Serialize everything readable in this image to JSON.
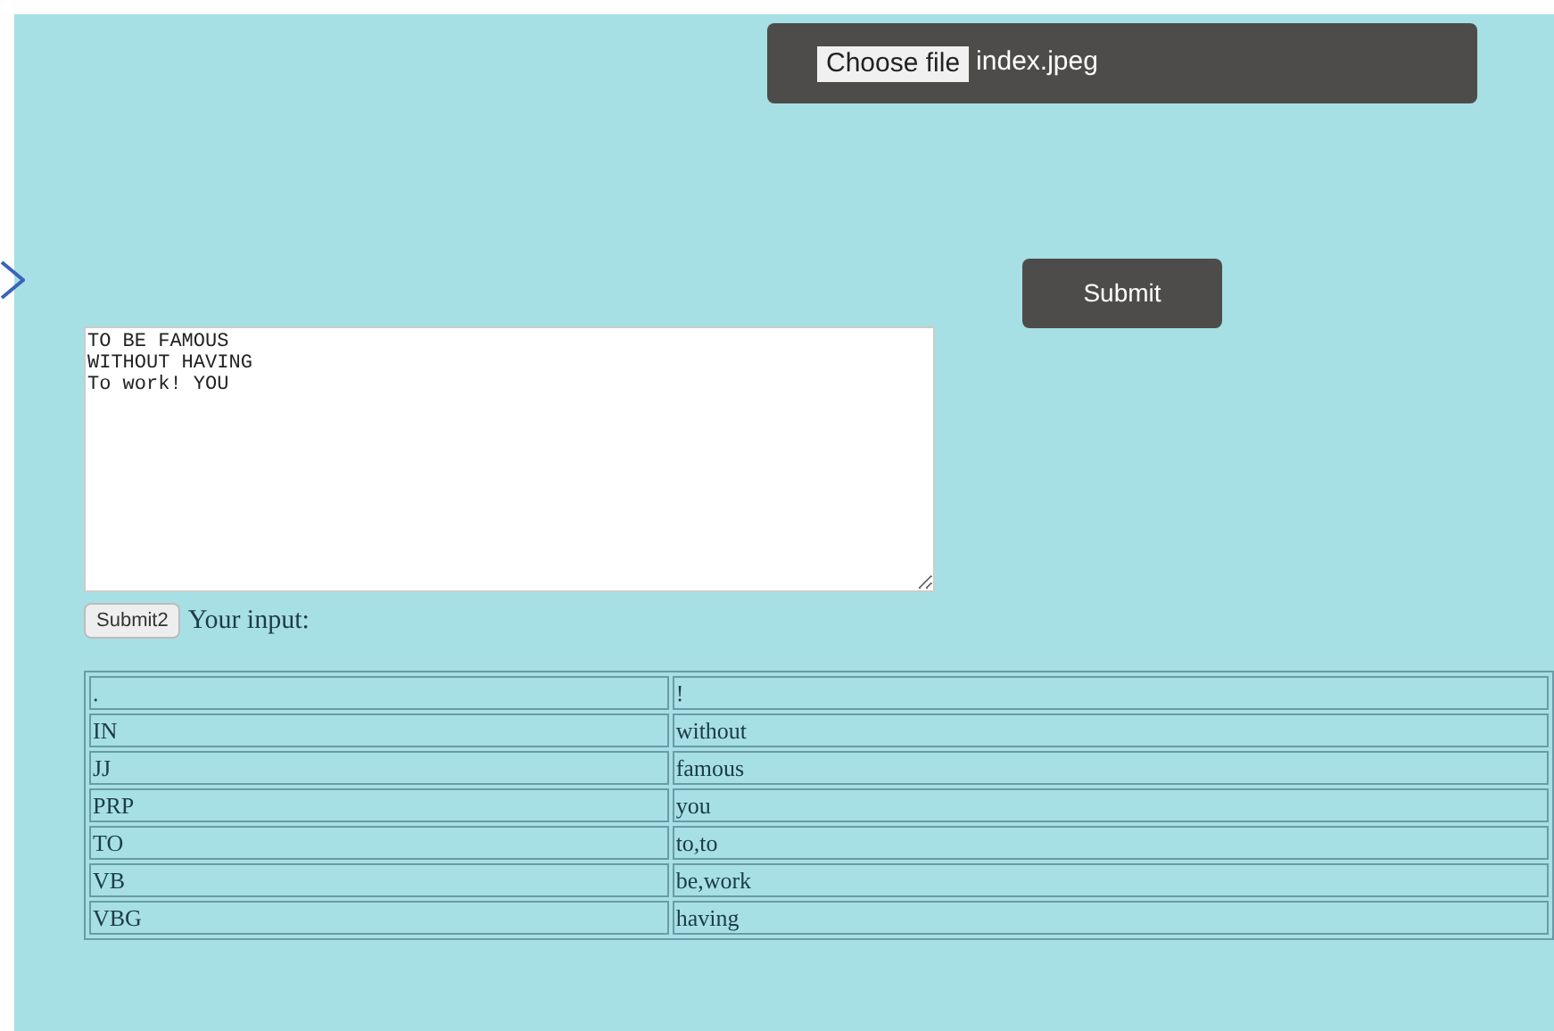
{
  "file_picker": {
    "button": "Choose file",
    "file_name": "index.jpeg"
  },
  "submit_button": "Submit",
  "textarea": {
    "value": "TO BE FAMOUS\nWITHOUT HAVING\nTo work! YOU"
  },
  "submit2_button": "Submit2",
  "result_label": "Your input:",
  "table": {
    "rows": [
      [
        ".",
        "!"
      ],
      [
        "IN",
        "without"
      ],
      [
        "JJ",
        "famous"
      ],
      [
        "PRP",
        "you"
      ],
      [
        "TO",
        "to,to"
      ],
      [
        "VB",
        "be,work"
      ],
      [
        "VBG",
        "having"
      ]
    ]
  }
}
